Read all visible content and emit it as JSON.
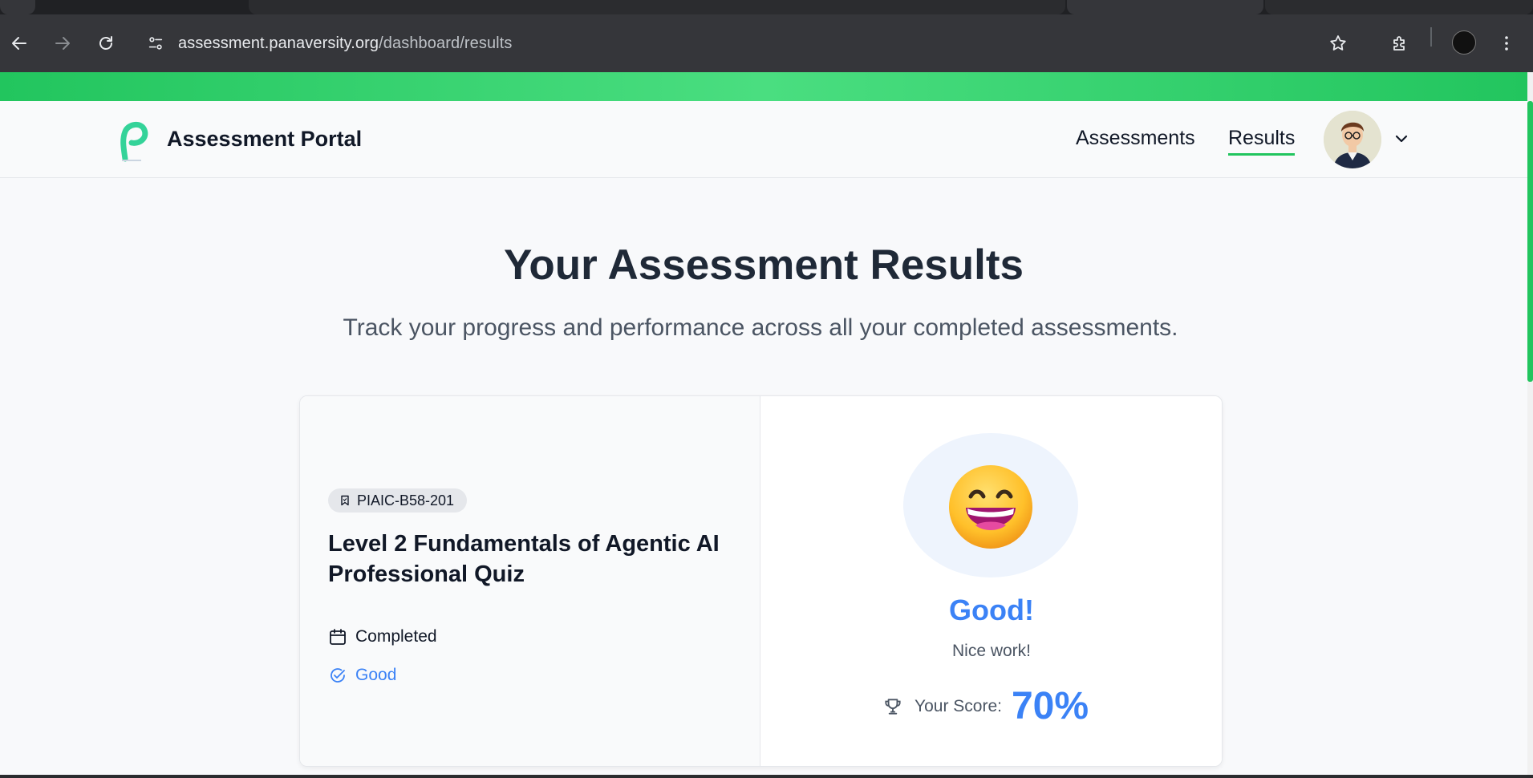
{
  "browser": {
    "url_host": "assessment.panaversity.org",
    "url_path": "/dashboard/results"
  },
  "header": {
    "brand": "Assessment Portal",
    "nav": {
      "assessments": "Assessments",
      "results": "Results"
    }
  },
  "main": {
    "title": "Your Assessment Results",
    "subtitle": "Track your progress and performance across all your completed assessments."
  },
  "result_card": {
    "badge": "PIAIC-B58-201",
    "quiz_title": "Level 2 Fundamentals of Agentic AI Professional Quiz",
    "status": "Completed",
    "grade": "Good",
    "rating": "Good!",
    "praise": "Nice work!",
    "score_label": "Your Score:",
    "score_value": "70%"
  },
  "colors": {
    "accent_green": "#22c55e",
    "accent_blue": "#3b82f6"
  }
}
